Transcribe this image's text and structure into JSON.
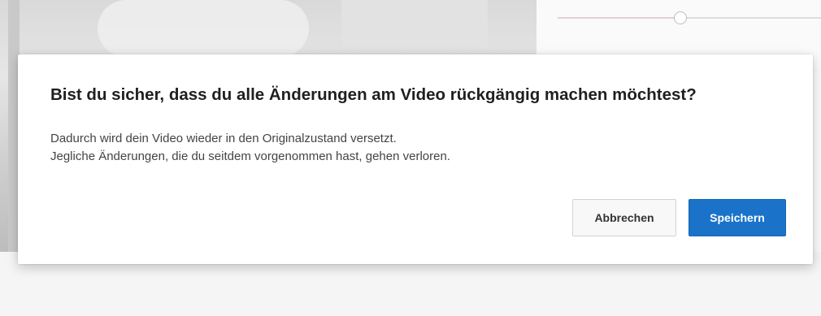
{
  "dialog": {
    "title": "Bist du sicher, dass du alle Änderungen am Video rückgängig machen möchtest?",
    "body_line_1": "Dadurch wird dein Video wieder in den Originalzustand versetzt.",
    "body_line_2": "Jegliche Änderungen, die du seitdem vorgenommen hast, gehen verloren.",
    "cancel_label": "Abbrechen",
    "save_label": "Speichern"
  },
  "colors": {
    "primary_button": "#1a73c8",
    "secondary_button": "#f8f8f8"
  }
}
